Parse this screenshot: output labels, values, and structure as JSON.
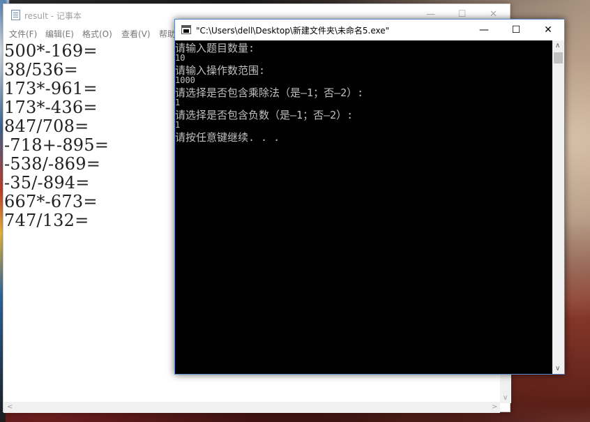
{
  "notepad": {
    "title": "result - 记事本",
    "menus": [
      "文件(F)",
      "编辑(E)",
      "格式(O)",
      "查看(V)",
      "帮助"
    ],
    "lines": [
      "500*-169=",
      "38/536=",
      "173*-961=",
      "173*-436=",
      "847/708=",
      "-718+-895=",
      "-538/-869=",
      "-35/-894=",
      "667*-673=",
      "747/132="
    ]
  },
  "console": {
    "title": "\"C:\\Users\\dell\\Desktop\\新建文件夹\\未命名5.exe\"",
    "lines": [
      {
        "text": "请输入题目数量:",
        "size": "big"
      },
      {
        "text": "10",
        "size": "small"
      },
      {
        "text": "请输入操作数范围:",
        "size": "big"
      },
      {
        "text": "1000",
        "size": "small"
      },
      {
        "text": "请选择是否包含乘除法（是—1；否—2）:",
        "size": "big"
      },
      {
        "text": "1",
        "size": "small"
      },
      {
        "text": "请选择是否包含负数（是—1；否—2）:",
        "size": "big"
      },
      {
        "text": "1",
        "size": "small"
      },
      {
        "text": "请按任意键继续. . .",
        "size": "big"
      }
    ]
  },
  "icons": {
    "minimize": "minimize-icon",
    "maximize": "maximize-icon",
    "close": "close-icon"
  },
  "colors": {
    "console_bg": "#000000",
    "console_text": "#c0c0c0",
    "notepad_bg": "#ffffff",
    "active_border": "#5c88c9"
  }
}
